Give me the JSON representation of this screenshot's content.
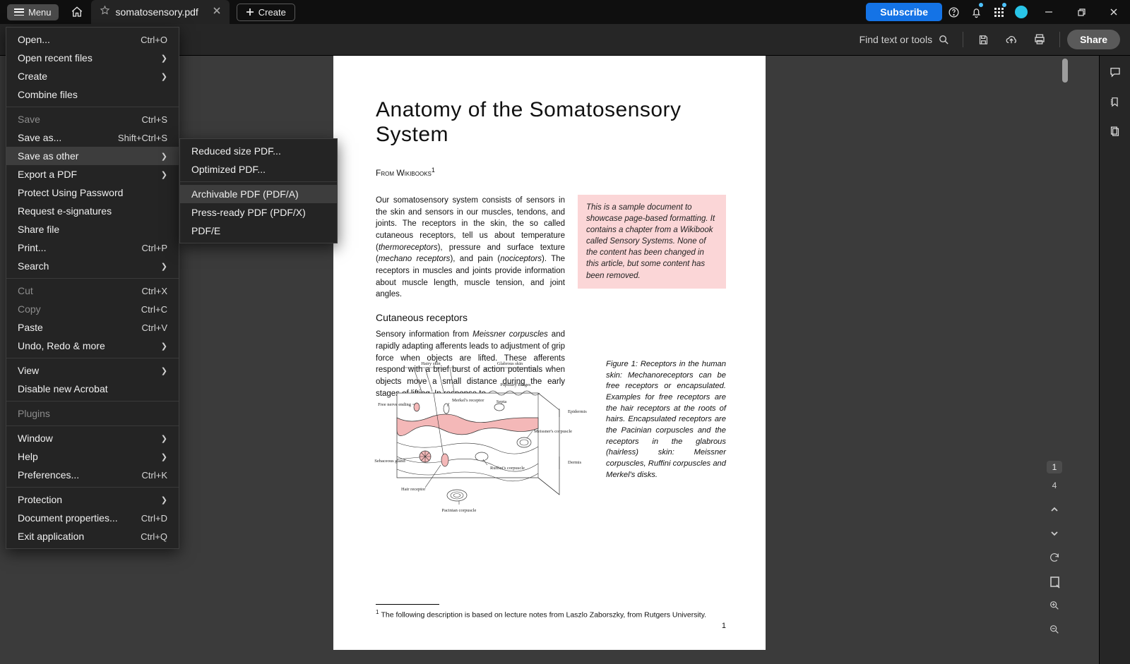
{
  "titlebar": {
    "menu_label": "Menu",
    "tab_title": "somatosensory.pdf",
    "create_label": "Create",
    "subscribe_label": "Subscribe"
  },
  "subbar": {
    "find_placeholder": "Find text or tools",
    "share_label": "Share"
  },
  "menu": {
    "items": [
      {
        "label": "Open...",
        "shortcut": "Ctrl+O"
      },
      {
        "label": "Open recent files",
        "sub": true
      },
      {
        "label": "Create",
        "sub": true
      },
      {
        "label": "Combine files"
      },
      {
        "sep": true
      },
      {
        "label": "Save",
        "shortcut": "Ctrl+S",
        "disabled": true
      },
      {
        "label": "Save as...",
        "shortcut": "Shift+Ctrl+S"
      },
      {
        "label": "Save as other",
        "sub": true,
        "hover": true
      },
      {
        "label": "Export a PDF",
        "sub": true
      },
      {
        "label": "Protect Using Password"
      },
      {
        "label": "Request e-signatures"
      },
      {
        "label": "Share file"
      },
      {
        "label": "Print...",
        "shortcut": "Ctrl+P"
      },
      {
        "label": "Search",
        "sub": true
      },
      {
        "sep": true
      },
      {
        "label": "Cut",
        "shortcut": "Ctrl+X",
        "disabled": true
      },
      {
        "label": "Copy",
        "shortcut": "Ctrl+C",
        "disabled": true
      },
      {
        "label": "Paste",
        "shortcut": "Ctrl+V"
      },
      {
        "label": "Undo, Redo & more",
        "sub": true
      },
      {
        "sep": true
      },
      {
        "label": "View",
        "sub": true
      },
      {
        "label": "Disable new Acrobat"
      },
      {
        "sep": true
      },
      {
        "label": "Plugins",
        "disabled": true
      },
      {
        "sep": true
      },
      {
        "label": "Window",
        "sub": true
      },
      {
        "label": "Help",
        "sub": true
      },
      {
        "label": "Preferences...",
        "shortcut": "Ctrl+K"
      },
      {
        "sep": true
      },
      {
        "label": "Protection",
        "sub": true
      },
      {
        "label": "Document properties...",
        "shortcut": "Ctrl+D"
      },
      {
        "label": "Exit application",
        "shortcut": "Ctrl+Q"
      }
    ]
  },
  "submenu": {
    "items": [
      {
        "label": "Reduced size PDF..."
      },
      {
        "label": "Optimized PDF..."
      },
      {
        "sep": true
      },
      {
        "label": "Archivable PDF (PDF/A)",
        "hover": true
      },
      {
        "label": "Press-ready PDF (PDF/X)"
      },
      {
        "label": "PDF/E"
      }
    ]
  },
  "right_tools": {
    "current_page": "1",
    "total_pages": "4"
  },
  "doc": {
    "title": "Anatomy of the Somatosensory System",
    "from": "From Wikibooks",
    "callout": "This is a sample document to showcase page-based formatting. It contains a chapter from a Wikibook called Sensory Systems. None of the content has been changed in this article, but some content has been removed.",
    "p1_a": "Our somatosensory system consists of sensors in the skin and sensors in our muscles, tendons, and joints. The receptors in the skin, the so called cutaneous receptors, tell us about temperature (",
    "p1_b": "thermoreceptors",
    "p1_c": "), pressure and surface texture (",
    "p1_d": "mechano receptors",
    "p1_e": "), and pain (",
    "p1_f": "nociceptors",
    "p1_g": "). The receptors in muscles and joints provide information about muscle length, muscle tension, and joint angles.",
    "h2": "Cutaneous receptors",
    "p2_a": "Sensory information from ",
    "p2_b": "Meissner corpuscles",
    "p2_c": " and rapidly adapting afferents leads to adjustment of grip force when objects are lifted. These afferents respond with a brief burst of action potentials when objects move a small distance during the early stages of lifting. In response to",
    "fig_labels": {
      "hairy": "Hairy skin",
      "glabrous": "Glabrous skin",
      "pap": "Papillary Ridges",
      "epi": "Epidermis",
      "dermis": "Dermis",
      "free": "Free nerve ending",
      "merkel": "Merkel's receptor",
      "meiss": "Meissner's corpuscle",
      "ruff": "Ruffini's corpuscle",
      "hair": "Hair receptor",
      "pac": "Pacinian corpuscle",
      "seb": "Sebaceous gland",
      "septa": "Septa"
    },
    "figcap": "Figure 1:  Receptors in the human skin: Mechanoreceptors can be free receptors or encapsulated. Examples for free receptors are the hair receptors at the roots of hairs. Encapsulated receptors are the Pacinian corpuscles and the receptors in the glabrous (hairless) skin: Meissner corpuscles, Ruffini corpuscles and Merkel's disks.",
    "footnote": "The following description is based on lecture notes from Laszlo Zaborszky, from Rutgers University.",
    "pagenum": "1"
  }
}
